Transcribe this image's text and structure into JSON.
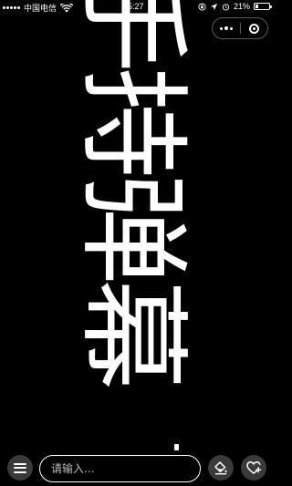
{
  "status_bar": {
    "carrier": "中国电信",
    "time": "5:27",
    "battery_percent": "21%",
    "battery_level": 0.21,
    "icons": [
      "signal-icon",
      "wifi-icon",
      "lock-rotation-icon",
      "location-icon",
      "alarm-icon",
      "battery-icon"
    ]
  },
  "capsule": {
    "more_icon": "more-dots-icon",
    "close_icon": "close-target-icon"
  },
  "danmaku": {
    "text": "手持弹幕",
    "text_color": "#ffffff",
    "background_color": "#000000",
    "orientation": "vertical"
  },
  "toolbar": {
    "menu_icon": "menu-icon",
    "input_placeholder": "请输入...",
    "input_value": "",
    "paint_icon": "paint-bucket-icon",
    "favorite_icon": "heart-plus-icon"
  }
}
